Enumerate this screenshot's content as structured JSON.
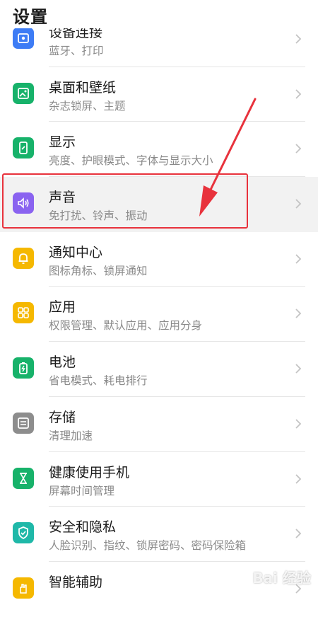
{
  "header": {
    "title": "设置"
  },
  "items": [
    {
      "label": "设备连接",
      "sub": "蓝牙、打印",
      "icon": "device-connection-icon",
      "color": "#3d7cf5"
    },
    {
      "label": "桌面和壁纸",
      "sub": "杂志锁屏、主题",
      "icon": "wallpaper-icon",
      "color": "#17b26a"
    },
    {
      "label": "显示",
      "sub": "亮度、护眼模式、字体与显示大小",
      "icon": "display-icon",
      "color": "#17b26a"
    },
    {
      "label": "声音",
      "sub": "免打扰、铃声、振动",
      "icon": "speaker-icon",
      "color": "#8a63f0"
    },
    {
      "label": "通知中心",
      "sub": "图标角标、锁屏通知",
      "icon": "bell-icon",
      "color": "#f5b800"
    },
    {
      "label": "应用",
      "sub": "权限管理、默认应用、应用分身",
      "icon": "apps-grid-icon",
      "color": "#f5b800"
    },
    {
      "label": "电池",
      "sub": "省电模式、耗电排行",
      "icon": "battery-icon",
      "color": "#17b26a"
    },
    {
      "label": "存储",
      "sub": "清理加速",
      "icon": "storage-icon",
      "color": "#8d8d8d"
    },
    {
      "label": "健康使用手机",
      "sub": "屏幕时间管理",
      "icon": "hourglass-icon",
      "color": "#17b26a"
    },
    {
      "label": "安全和隐私",
      "sub": "人脸识别、指纹、锁屏密码、密码保险箱",
      "icon": "shield-icon",
      "color": "#1fb8a8"
    },
    {
      "label": "智能辅助",
      "sub": "",
      "icon": "hand-icon",
      "color": "#f5b800"
    }
  ],
  "watermark": "Bai 经验",
  "annotation": {
    "color": "#e8323c"
  }
}
